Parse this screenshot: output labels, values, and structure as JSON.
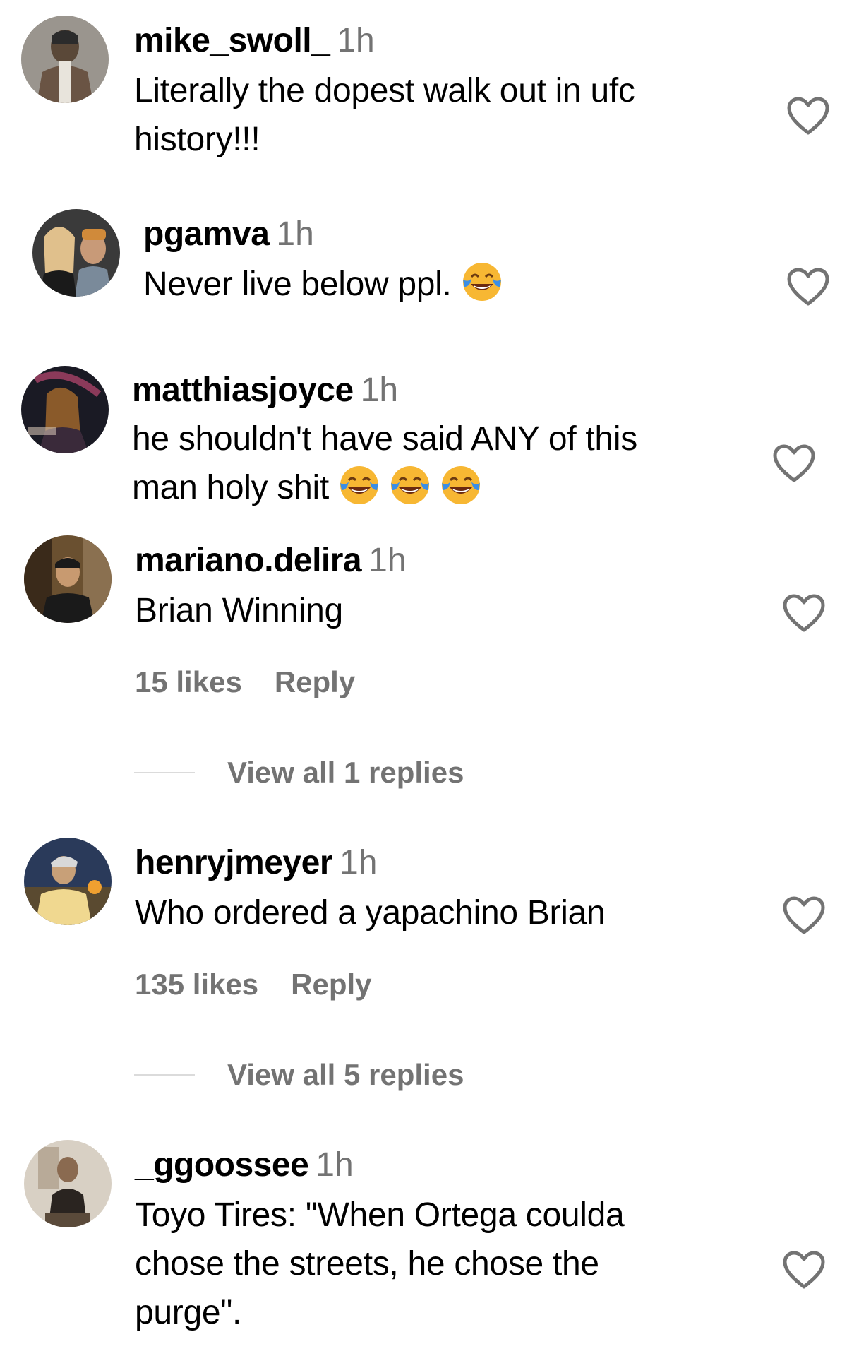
{
  "comments": [
    {
      "username": "mike_swoll_",
      "time": "1h",
      "lines": [
        "Literally the dopest walk out in ufc",
        "history!!!"
      ],
      "avatar_colors": [
        "#5a5a5a",
        "#2b2b2b",
        "#d8d2c8"
      ]
    },
    {
      "username": "pgamva",
      "time": "1h",
      "lines": [
        "Never live below ppl."
      ],
      "emojis": [
        "tears-of-joy"
      ],
      "avatar_colors": [
        "#e0c08c",
        "#3a3a3a",
        "#7a6a58"
      ]
    },
    {
      "username": "matthiasjoyce",
      "time": "1h",
      "lines": [
        "he shouldn't have said ANY of this",
        "man holy shit"
      ],
      "emojis": [
        "tears-of-joy",
        "tears-of-joy",
        "tears-of-joy"
      ],
      "avatar_colors": [
        "#1a1a24",
        "#8b3a5a",
        "#c8a070"
      ]
    },
    {
      "username": "mariano.delira",
      "time": "1h",
      "lines": [
        "Brian Winning"
      ],
      "likes": "15 likes",
      "reply_label": "Reply",
      "view_replies": "View all 1 replies",
      "avatar_colors": [
        "#6a5030",
        "#1a1a1a",
        "#c89a70"
      ]
    },
    {
      "username": "henryjmeyer",
      "time": "1h",
      "lines": [
        "Who ordered a yapachino Brian"
      ],
      "likes": "135 likes",
      "reply_label": "Reply",
      "view_replies": "View all 5 replies",
      "avatar_colors": [
        "#2a3a5a",
        "#f0d890",
        "#c8a078"
      ]
    },
    {
      "username": "_ggoossee",
      "time": "1h",
      "lines": [
        "Toyo Tires: \"When Ortega coulda",
        "chose the streets, he chose the",
        "purge\"."
      ],
      "avatar_colors": [
        "#d8d0c4",
        "#2a2420",
        "#8a6a50"
      ]
    }
  ],
  "icons": {
    "like": "heart-outline-icon",
    "emoji": "face-with-tears-of-joy-emoji"
  },
  "colors": {
    "text": "#000000",
    "secondary": "#737373",
    "divider": "#dbdbdb",
    "emoji_face": "#f7b733",
    "emoji_tears": "#3a8ee6"
  }
}
